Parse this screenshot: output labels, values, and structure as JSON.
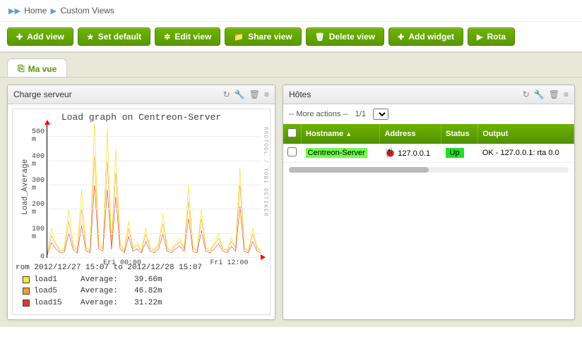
{
  "breadcrumb": {
    "home": "Home",
    "current": "Custom Views"
  },
  "toolbar": {
    "add_view": "Add view",
    "set_default": "Set default",
    "edit_view": "Edit view",
    "share_view": "Share view",
    "delete_view": "Delete view",
    "add_widget": "Add widget",
    "rotation": "Rota"
  },
  "tabs": {
    "ma_vue": "Ma vue"
  },
  "widget_charge": {
    "title": "Charge serveur"
  },
  "widget_hosts": {
    "title": "Hôtes"
  },
  "hosts": {
    "more_actions": "-- More actions --",
    "pagination": "1/1",
    "cols": {
      "hostname": "Hostname",
      "address": "Address",
      "status": "Status",
      "output": "Output"
    },
    "rows": [
      {
        "hostname": "Centreon-Server",
        "address": "127.0.0.1",
        "status": "Up",
        "output": "OK - 127.0.0.1: rta 0.0"
      }
    ]
  },
  "chart_data": {
    "type": "line",
    "title": "Load graph on Centreon-Server",
    "ylabel": "Load_Average",
    "rlabel": "RRDTOOL / TOBI OETIKER",
    "ylim": [
      0,
      550
    ],
    "yticks": [
      0,
      100,
      200,
      300,
      400,
      500
    ],
    "ytick_labels": [
      "0",
      "100 m",
      "200 m",
      "300 m",
      "400 m",
      "500 m"
    ],
    "xtick_labels": [
      "Fri 00:00",
      "Fri 12:00"
    ],
    "xtick_pos": [
      0.35,
      0.85
    ],
    "range_text": "rom 2012/12/27 15:07 to 2012/12/28 15:07",
    "series": [
      {
        "name": "load1",
        "color": "#f5e63a",
        "avg_label": "Average:",
        "avg": "39.66m"
      },
      {
        "name": "load5",
        "color": "#f0a029",
        "avg_label": "Average:",
        "avg": "46.82m"
      },
      {
        "name": "load15",
        "color": "#e03a2a",
        "avg_label": "Average:",
        "avg": "31.22m"
      }
    ],
    "x": [
      0,
      2,
      4,
      6,
      8,
      10,
      12,
      14,
      16,
      18,
      20,
      22,
      24,
      26,
      28,
      30,
      32,
      34,
      36,
      38,
      40,
      42,
      44,
      46,
      48,
      50,
      52,
      54,
      56,
      58,
      60,
      62,
      64,
      66,
      68,
      70,
      72,
      74,
      76,
      78,
      80,
      82,
      84,
      86,
      88,
      90,
      92,
      94,
      96,
      98,
      100
    ],
    "load1": [
      20,
      120,
      60,
      30,
      40,
      200,
      60,
      30,
      280,
      50,
      30,
      560,
      60,
      40,
      530,
      50,
      450,
      60,
      30,
      150,
      40,
      60,
      30,
      120,
      40,
      30,
      60,
      180,
      40,
      30,
      60,
      80,
      40,
      300,
      40,
      30,
      200,
      40,
      30,
      60,
      100,
      40,
      30,
      80,
      40,
      370,
      40,
      30,
      120,
      40,
      30
    ],
    "load5": [
      15,
      90,
      50,
      25,
      30,
      150,
      45,
      25,
      200,
      40,
      25,
      420,
      50,
      35,
      400,
      45,
      350,
      50,
      25,
      120,
      35,
      50,
      25,
      95,
      35,
      25,
      50,
      140,
      35,
      25,
      50,
      65,
      35,
      230,
      35,
      25,
      160,
      35,
      25,
      50,
      80,
      35,
      25,
      65,
      35,
      300,
      35,
      25,
      95,
      35,
      25
    ],
    "load15": [
      10,
      60,
      35,
      18,
      22,
      100,
      32,
      18,
      130,
      28,
      18,
      300,
      35,
      25,
      280,
      32,
      250,
      35,
      18,
      85,
      25,
      35,
      18,
      65,
      25,
      18,
      35,
      95,
      25,
      18,
      35,
      45,
      25,
      160,
      25,
      18,
      110,
      25,
      18,
      35,
      55,
      25,
      18,
      45,
      25,
      210,
      25,
      18,
      65,
      25,
      18
    ]
  }
}
